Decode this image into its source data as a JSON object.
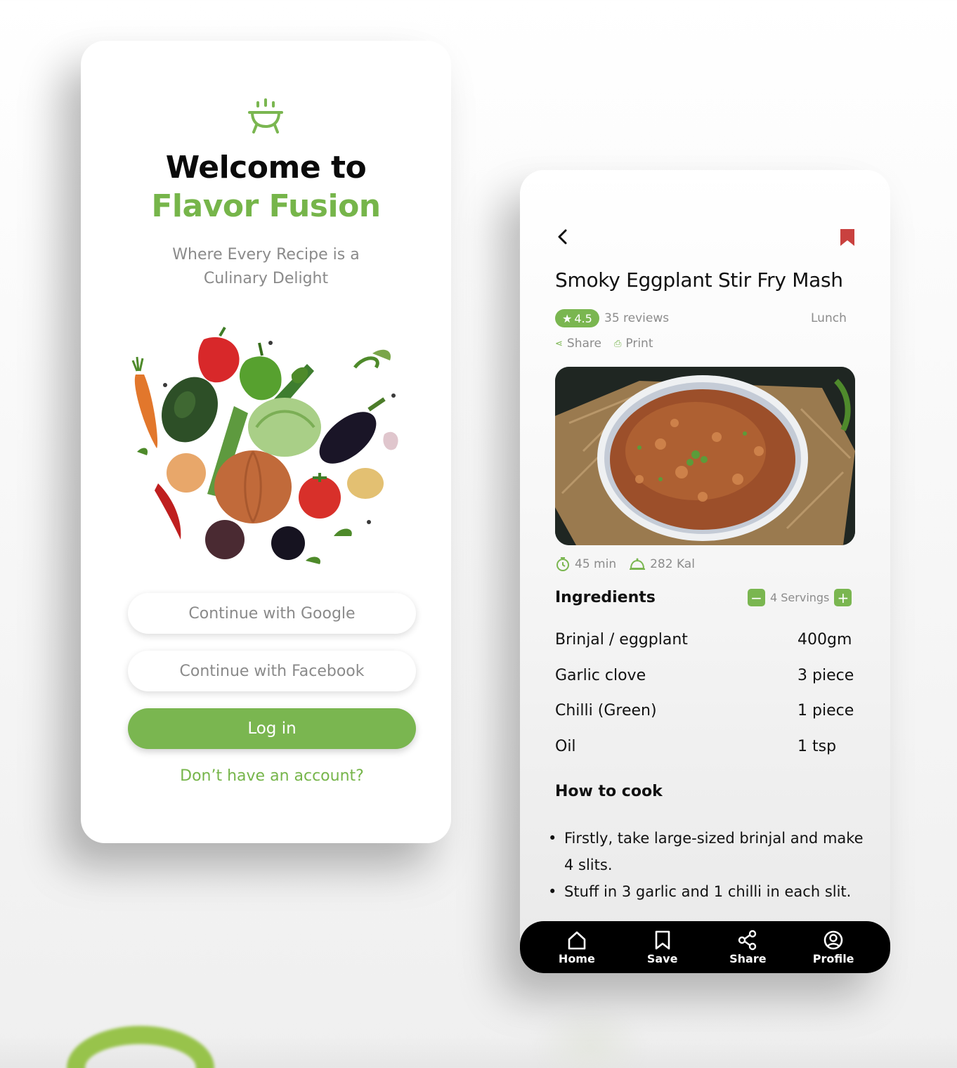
{
  "welcome_screen": {
    "title_line1": "Welcome to",
    "title_line2": "Flavor Fusion",
    "tagline": "Where Every Recipe is a Culinary Delight",
    "google_button": "Continue with Google",
    "facebook_button": "Continue with Facebook",
    "login_button": "Log in",
    "signup_link": "Don’t have an account?"
  },
  "recipe_screen": {
    "title": "Smoky Eggplant Stir Fry Mash",
    "rating": "4.5",
    "reviews": "35 reviews",
    "category": "Lunch",
    "share_label": "Share",
    "print_label": "Print",
    "time": "45 min",
    "calories": "282 Kal",
    "ingredients_heading": "Ingredients",
    "servings": "4 Servings",
    "ingredients": [
      {
        "name": "Brinjal / eggplant",
        "qty": "400gm"
      },
      {
        "name": "Garlic clove",
        "qty": "3 piece"
      },
      {
        "name": "Chilli (Green)",
        "qty": "1 piece"
      },
      {
        "name": "Oil",
        "qty": "1 tsp"
      }
    ],
    "howto_heading": "How to cook",
    "steps": [
      "Firstly, take large-sized brinjal and make 4 slits.",
      "Stuff in 3 garlic and 1 chilli in each slit."
    ],
    "nav": [
      "Home",
      "Save",
      "Share",
      "Profile"
    ]
  },
  "colors": {
    "brand_green": "#7ab650",
    "bookmark_red": "#c9413f",
    "nav_bg": "#000000"
  },
  "icons": [
    "pot-icon",
    "back-icon",
    "bookmark-icon",
    "star-icon",
    "share-icon",
    "print-icon",
    "timer-icon",
    "dish-icon",
    "minus-icon",
    "plus-icon",
    "home-icon",
    "save-icon",
    "share-nav-icon",
    "profile-icon"
  ]
}
